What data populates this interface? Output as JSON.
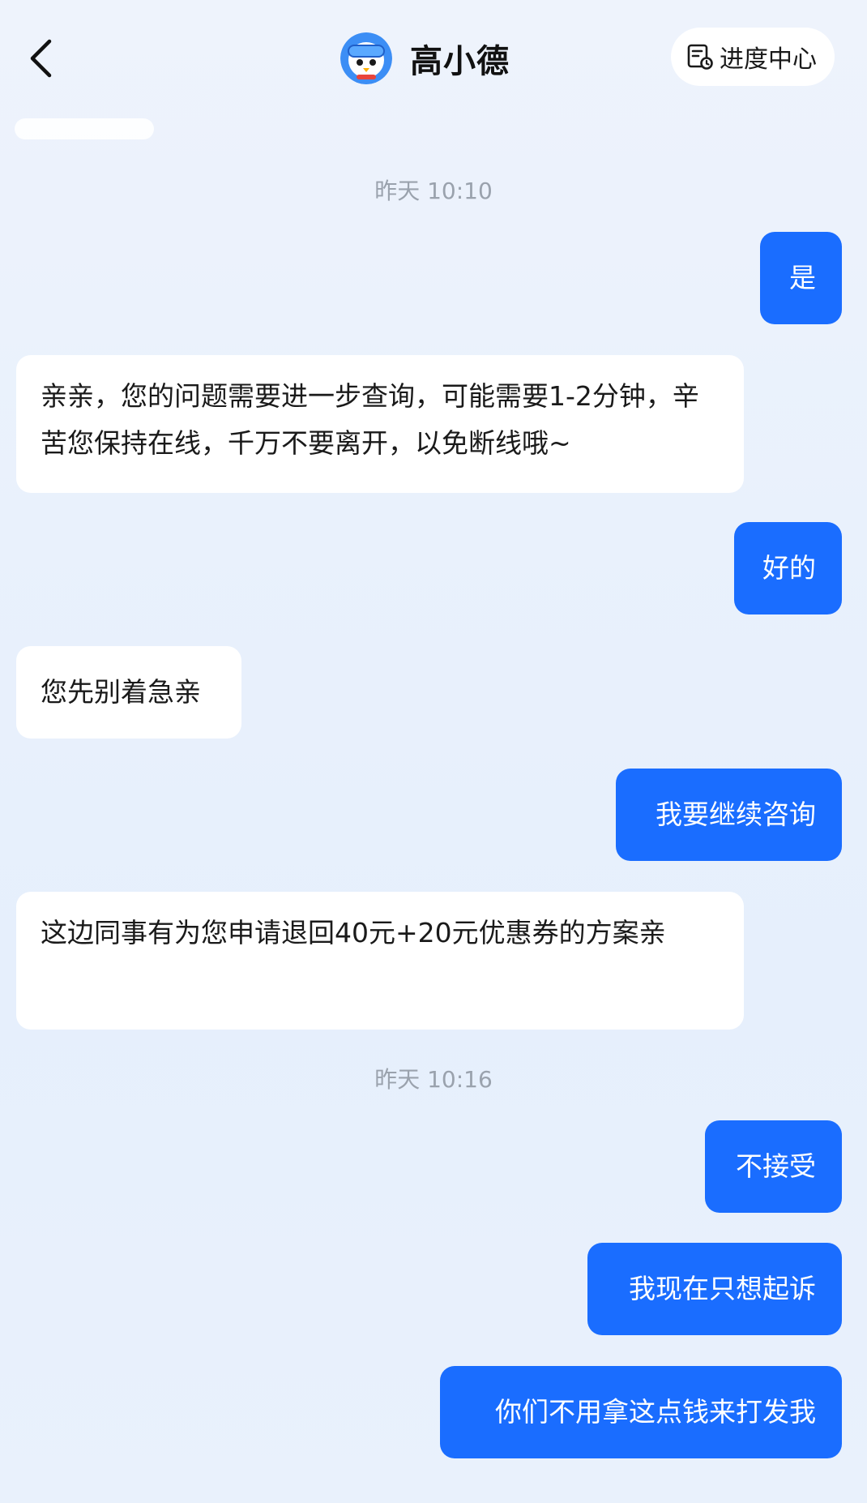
{
  "header": {
    "title": "高小德",
    "progress_label": "进度中心"
  },
  "messages": [
    {
      "type": "timestamp",
      "text": "昨天 10:10"
    },
    {
      "type": "user",
      "text": "是"
    },
    {
      "type": "agent",
      "text": "亲亲，您的问题需要进一步查询，可能需要1-2分钟，辛苦您保持在线，千万不要离开，以免断线哦~"
    },
    {
      "type": "user",
      "text": "好的"
    },
    {
      "type": "agent",
      "text": "您先别着急亲"
    },
    {
      "type": "user",
      "text": "我要继续咨询"
    },
    {
      "type": "agent",
      "text": "这边同事有为您申请退回40元+20元优惠券的方案亲"
    },
    {
      "type": "timestamp",
      "text": "昨天 10:16"
    },
    {
      "type": "user",
      "text": "不接受"
    },
    {
      "type": "user",
      "text": "我现在只想起诉"
    },
    {
      "type": "user",
      "text": "你们不用拿这点钱来打发我"
    }
  ],
  "colors": {
    "user_bubble": "#1a6dff",
    "agent_bubble": "#ffffff",
    "timestamp": "#9aa2ad"
  },
  "icons": [
    "chevron-left-icon",
    "avatar-icon",
    "document-progress-icon"
  ]
}
